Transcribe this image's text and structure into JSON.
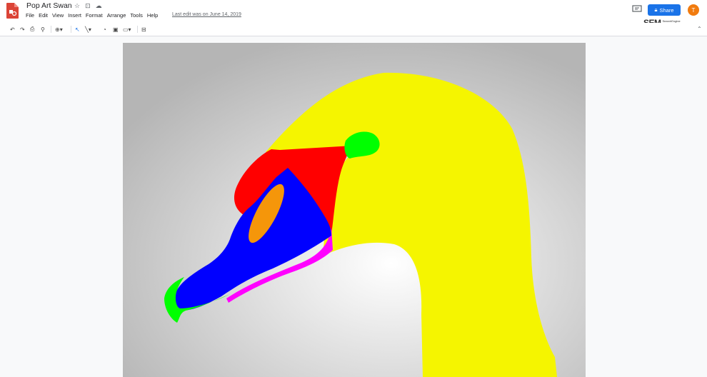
{
  "header": {
    "doc_title": "Pop Art Swan",
    "menu": [
      "File",
      "Edit",
      "View",
      "Insert",
      "Format",
      "Arrange",
      "Tools",
      "Help"
    ],
    "last_edit": "Last edit was on June 14, 2019",
    "share_label": "Share",
    "avatar_initial": "T"
  },
  "watermark": {
    "big": "SEM",
    "line1": "SearchEngine",
    "line2": "Magazine"
  },
  "toolbar": {
    "icons": [
      "undo-icon",
      "redo-icon",
      "print-icon",
      "paint-format-icon",
      "zoom-icon",
      "select-icon",
      "line-icon",
      "shape-icon",
      "text-box-icon",
      "image-icon",
      "comment-add-icon"
    ]
  },
  "drawing": {
    "colors": {
      "background_center": "#ffffff",
      "background_edge": "#b5b5b5",
      "neck": "#f5f500",
      "head_red": "#ff0000",
      "beak_blue": "#0000ff",
      "beak_spot": "#f5960a",
      "knob_green": "#00ff00",
      "lower_magenta": "#ff00ff",
      "tip_green": "#00ff00"
    }
  }
}
